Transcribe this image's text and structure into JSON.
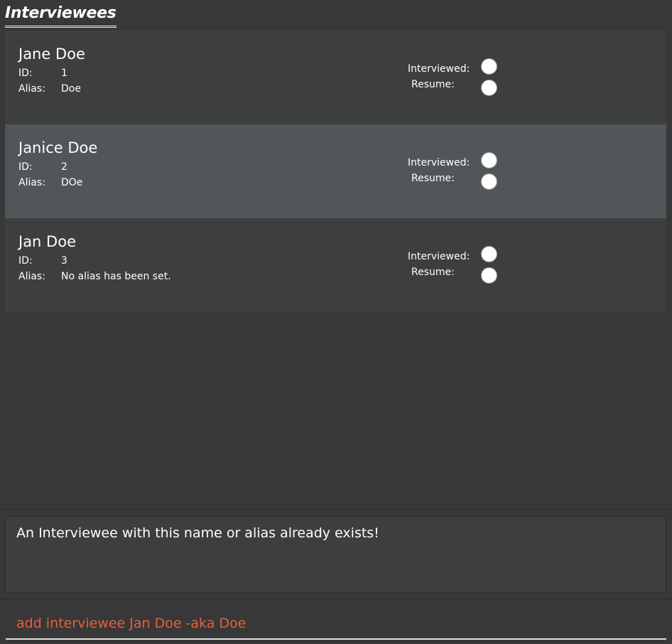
{
  "header": {
    "title": "Interviewees"
  },
  "labels": {
    "id": "ID:",
    "alias": "Alias:",
    "interviewed": "Interviewed:",
    "resume": "Resume:"
  },
  "interviewees": [
    {
      "name": "Jane Doe",
      "id": "1",
      "alias": "Doe",
      "interviewed": false,
      "resume": false,
      "selected": false
    },
    {
      "name": "Janice Doe",
      "id": "2",
      "alias": "DOe",
      "interviewed": false,
      "resume": false,
      "selected": true
    },
    {
      "name": "Jan Doe",
      "id": "3",
      "alias": "No alias has been set.",
      "interviewed": false,
      "resume": false,
      "selected": false
    }
  ],
  "result": {
    "message": "An Interviewee with this name or alias already exists!"
  },
  "command": {
    "value": "add interviewee Jan Doe -aka Doe"
  },
  "colors": {
    "background": "#383838",
    "card": "#3c3e3f",
    "card_selected": "#515658",
    "command_text": "#e5603f"
  }
}
